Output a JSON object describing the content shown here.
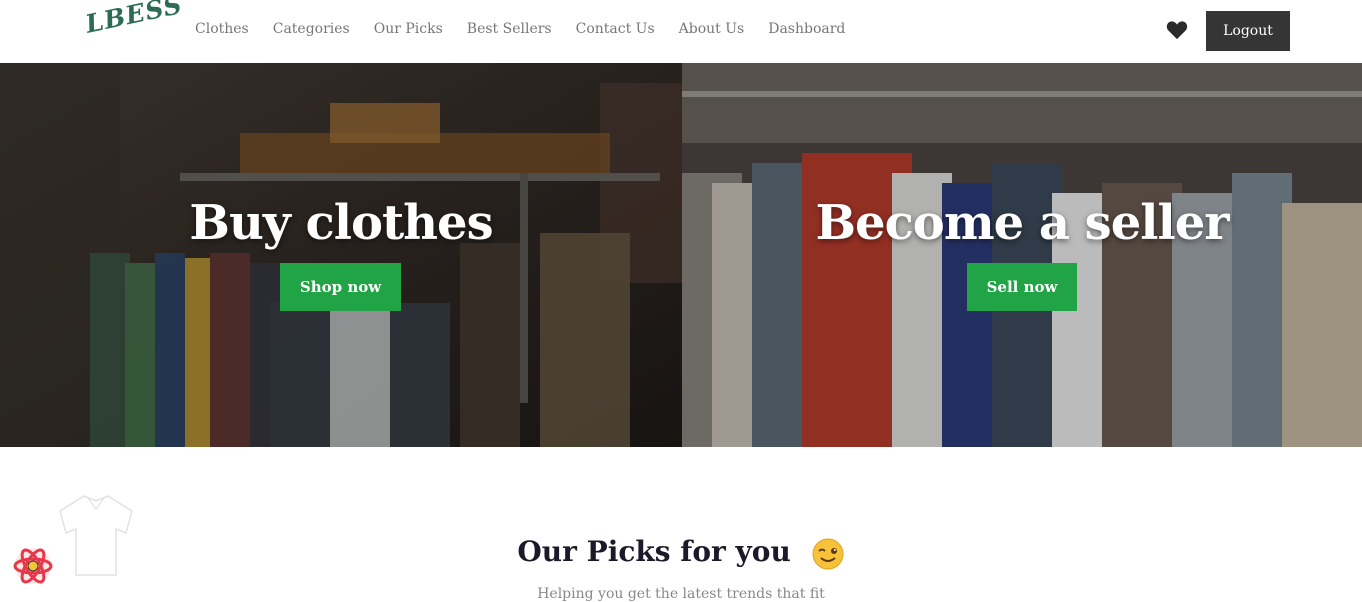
{
  "brand": {
    "logo": "LBESS"
  },
  "nav": {
    "links": [
      "Clothes",
      "Categories",
      "Our Picks",
      "Best Sellers",
      "Contact Us",
      "About Us",
      "Dashboard"
    ],
    "logout_label": "Logout"
  },
  "hero": {
    "left": {
      "title": "Buy clothes",
      "button": "Shop now"
    },
    "right": {
      "title": "Become a seller",
      "button": "Sell now"
    }
  },
  "section": {
    "title": "Our Picks for you",
    "subtitle": "Helping you get the latest trends that fit"
  },
  "colors": {
    "accent": "#20a445",
    "dark_button": "#353535",
    "logo": "#2d6b58"
  },
  "icons": [
    "heart-icon",
    "shirt-icon",
    "wink-emoji-icon",
    "react-devtools-icon"
  ]
}
